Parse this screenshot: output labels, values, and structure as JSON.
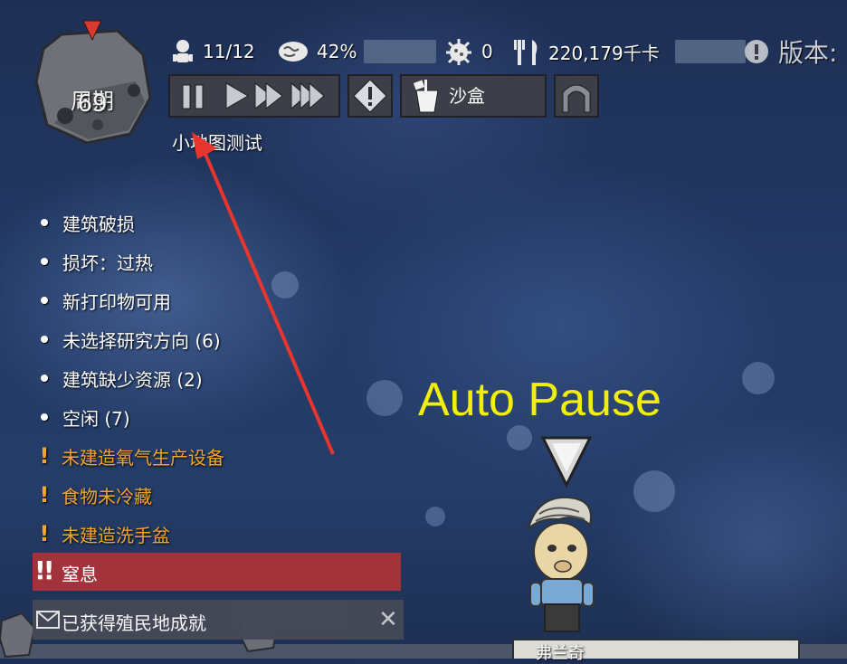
{
  "cycle": {
    "label": "周期",
    "number": "69"
  },
  "stats": {
    "duplicants": "11/12",
    "stress": "42%",
    "sick": "0",
    "calories": "220,179千卡",
    "version_label": "版本:"
  },
  "controls": {
    "sandbox_label": "沙盒"
  },
  "minimap_label": "小地图测试",
  "notifications": [
    {
      "text": "建筑破损",
      "kind": "info"
    },
    {
      "text": "损坏：过热",
      "kind": "info"
    },
    {
      "text": "新打印物可用",
      "kind": "info"
    },
    {
      "text": "未选择研究方向 (6)",
      "kind": "info"
    },
    {
      "text": "建筑缺少资源 (2)",
      "kind": "info"
    },
    {
      "text": "空闲 (7)",
      "kind": "info"
    },
    {
      "text": "未建造氧气生产设备",
      "kind": "warning"
    },
    {
      "text": "食物未冷藏",
      "kind": "warning"
    },
    {
      "text": "未建造洗手盆",
      "kind": "warning"
    }
  ],
  "alert": {
    "text": "窒息",
    "marker": "!!"
  },
  "achievement": {
    "text": "已获得殖民地成就",
    "close": "✕"
  },
  "overlay_caption": "Auto Pause",
  "duplicant_name": "弗兰奇",
  "colors": {
    "warning": "#f4a42e",
    "alert_bg": "#a2333a",
    "caption": "#f2ee0c",
    "arrow": "#e8352e"
  }
}
